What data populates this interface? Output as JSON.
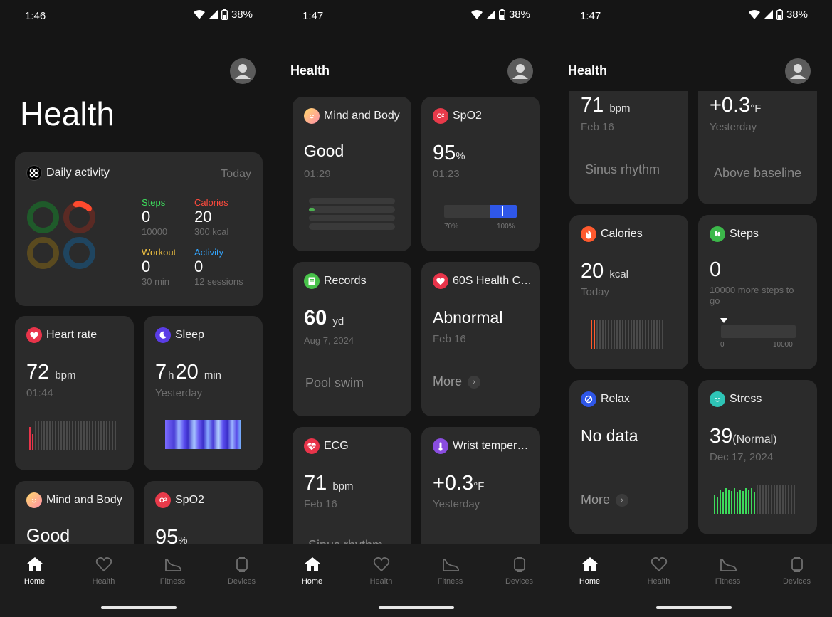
{
  "status": [
    {
      "time": "1:46",
      "battery": "38%"
    },
    {
      "time": "1:47",
      "battery": "38%"
    },
    {
      "time": "1:47",
      "battery": "38%"
    }
  ],
  "title_large": "Health",
  "title_small": "Health",
  "daily": {
    "title": "Daily activity",
    "date": "Today",
    "steps_label": "Steps",
    "steps_value": "0",
    "steps_goal": "10000",
    "calories_label": "Calories",
    "calories_value": "20",
    "calories_goal": "300 kcal",
    "workout_label": "Workout",
    "workout_value": "0",
    "workout_goal": "30 min",
    "activity_label": "Activity",
    "activity_value": "0",
    "activity_goal": "12 sessions"
  },
  "heart_rate": {
    "title": "Heart rate",
    "value": "72",
    "unit": "bpm",
    "time": "01:44"
  },
  "sleep": {
    "title": "Sleep",
    "hours": "7",
    "h": "h",
    "minutes": "20",
    "min": "min",
    "date": "Yesterday"
  },
  "mind_body": {
    "title": "Mind and Body",
    "value": "Good",
    "time": "01:29"
  },
  "spo2": {
    "title": "SpO2",
    "value": "95",
    "unit": "%",
    "time": "01:23",
    "scale_low": "70%",
    "scale_high": "100%"
  },
  "records": {
    "title": "Records",
    "value": "60",
    "unit": "yd",
    "date": "Aug 7, 2024",
    "status": "Pool swim"
  },
  "health60": {
    "title": "60S Health C…",
    "value": "Abnormal",
    "date": "Feb 16",
    "more": "More"
  },
  "ecg": {
    "title": "ECG",
    "value": "71",
    "unit": "bpm",
    "date": "Feb 16",
    "status": "Sinus rhythm",
    "status_cut": "Sinus rhythm"
  },
  "wrist": {
    "title": "Wrist temper…",
    "value": "+0.3",
    "unit": "°F",
    "date": "Yesterday",
    "status": "Above baseline"
  },
  "calories": {
    "title": "Calories",
    "value": "20",
    "unit": "kcal",
    "date": "Today"
  },
  "steps": {
    "title": "Steps",
    "value": "0",
    "sub": "10000 more steps to go",
    "scale_low": "0",
    "scale_high": "10000"
  },
  "relax": {
    "title": "Relax",
    "value": "No data",
    "more": "More"
  },
  "stress": {
    "title": "Stress",
    "value": "39",
    "qual": "(Normal)",
    "date": "Dec 17, 2024"
  },
  "nav": {
    "home": "Home",
    "health": "Health",
    "fitness": "Fitness",
    "devices": "Devices"
  },
  "colors": {
    "green": "#3ddc5c",
    "red": "#ff4a3d",
    "yellow": "#f5c542",
    "blue": "#33a6ff",
    "card": "#2b2b2b"
  }
}
